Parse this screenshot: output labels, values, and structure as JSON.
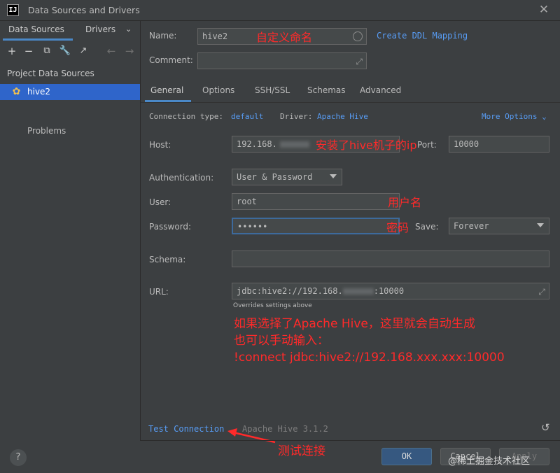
{
  "window": {
    "title": "Data Sources and Drivers",
    "app_icon_text": "IJ"
  },
  "left": {
    "tabs": [
      "Data Sources",
      "Drivers"
    ],
    "section_title": "Project Data Sources",
    "items": [
      {
        "label": "hive2"
      }
    ],
    "problems_label": "Problems"
  },
  "form": {
    "name_label": "Name:",
    "name_value": "hive2",
    "create_ddl_link": "Create DDL Mapping",
    "comment_label": "Comment:",
    "tabs": [
      "General",
      "Options",
      "SSH/SSL",
      "Schemas",
      "Advanced"
    ],
    "connection_type_label": "Connection type:",
    "connection_type_value": "default",
    "driver_label": "Driver:",
    "driver_value": "Apache Hive",
    "more_options": "More Options",
    "host_label": "Host:",
    "host_value": "192.168.",
    "port_label": "Port:",
    "port_value": "10000",
    "auth_label": "Authentication:",
    "auth_value": "User & Password",
    "user_label": "User:",
    "user_value": "root",
    "password_label": "Password:",
    "password_value": "••••••",
    "save_label": "Save:",
    "save_value": "Forever",
    "schema_label": "Schema:",
    "url_label": "URL:",
    "url_value": "jdbc:hive2://192.168.",
    "url_suffix": ":10000",
    "overrides_note": "Overrides settings above",
    "test_connection": "Test Connection",
    "driver_version": "Apache Hive 3.1.2"
  },
  "annotations": {
    "name_note": "自定义命名",
    "host_note": "安装了hive机子的ip",
    "user_note": "用户名",
    "password_note": "密码",
    "url_note_line1": "如果选择了Apache Hive，这里就会自动生成",
    "url_note_line2": "也可以手动输入：",
    "url_note_line3": "!connect jdbc:hive2://192.168.xxx.xxx:10000",
    "test_note": "测试连接"
  },
  "buttons": {
    "ok": "OK",
    "cancel": "Cancel",
    "apply": "Apply",
    "help": "?"
  },
  "watermark": "@稀土掘金技术社区",
  "colors": {
    "background": "#3c3f41",
    "selection": "#2f65ca",
    "link": "#589df6",
    "annotation": "#ff2a2a",
    "ok_button": "#365880"
  }
}
